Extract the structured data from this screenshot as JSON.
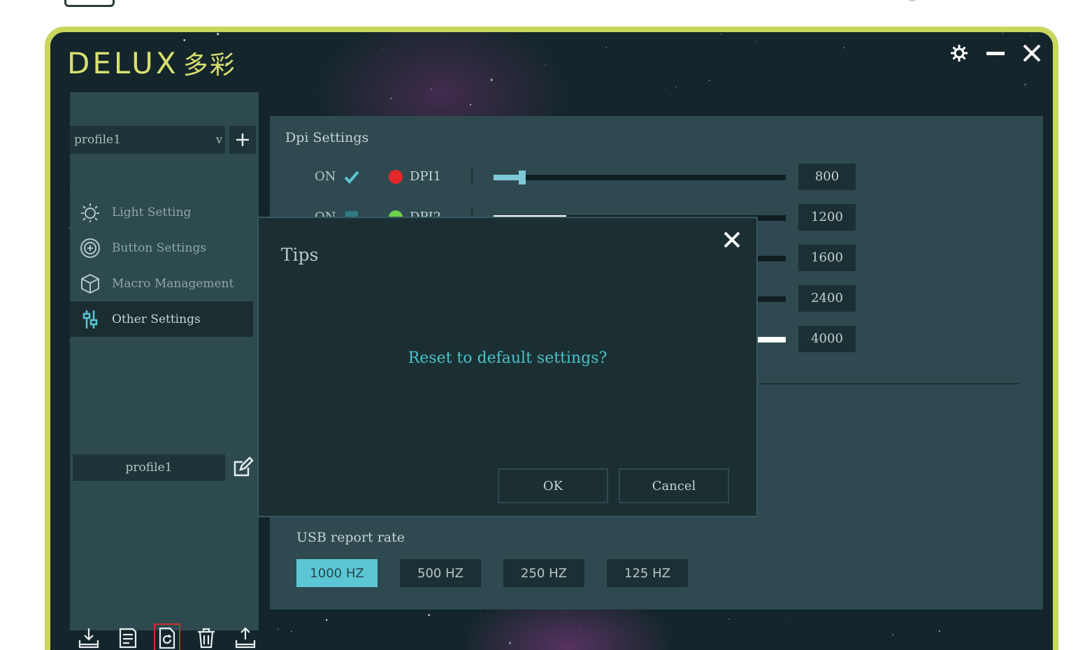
{
  "app": {
    "logo_text": "DELUX",
    "logo_cn": "多彩"
  },
  "window_controls": {
    "settings_icon": "gear-icon",
    "minimize_icon": "minimize-icon",
    "close_icon": "close-icon"
  },
  "sidebar": {
    "profile_select": {
      "value": "profile1",
      "caret": "v"
    },
    "add_profile_icon": "plus-icon",
    "menu": [
      {
        "label": "Light Setting",
        "icon": "sun-icon",
        "active": false
      },
      {
        "label": "Button Settings",
        "icon": "button-icon",
        "active": false
      },
      {
        "label": "Macro Management",
        "icon": "cube-icon",
        "active": false
      },
      {
        "label": "Other Settings",
        "icon": "sliders-icon",
        "active": true
      }
    ],
    "profile_name": "profile1",
    "edit_icon": "edit-icon",
    "toolbar": [
      {
        "icon": "import-icon"
      },
      {
        "icon": "save-icon"
      },
      {
        "icon": "reset-icon",
        "highlighted": true
      },
      {
        "icon": "trash-icon"
      },
      {
        "icon": "export-icon"
      }
    ]
  },
  "dpi_settings": {
    "title": "Dpi Settings",
    "rows": [
      {
        "on_label": "ON",
        "enabled": true,
        "name": "DPI1",
        "dot_color": "#e5282c",
        "value": "800",
        "fill_fraction": 0.1
      },
      {
        "on_label": "ON",
        "enabled": false,
        "name": "DPI2",
        "dot_color": "#6bd04a",
        "value": "1200",
        "fill_fraction": 0.25
      },
      {
        "on_label": "",
        "enabled": false,
        "name": "",
        "dot_color": "",
        "value": "1600",
        "fill_fraction": 0.33
      },
      {
        "on_label": "",
        "enabled": false,
        "name": "",
        "dot_color": "",
        "value": "2400",
        "fill_fraction": 0.5
      },
      {
        "on_label": "",
        "enabled": false,
        "name": "",
        "dot_color": "",
        "value": "4000",
        "fill_fraction": 1.0
      }
    ]
  },
  "usb": {
    "title": "USB report rate",
    "rates": [
      {
        "label": "1000 HZ",
        "selected": true
      },
      {
        "label": "500 HZ",
        "selected": false
      },
      {
        "label": "250 HZ",
        "selected": false
      },
      {
        "label": "125 HZ",
        "selected": false
      }
    ]
  },
  "dialog": {
    "title": "Tips",
    "message": "Reset to default settings?",
    "ok_label": "OK",
    "cancel_label": "Cancel",
    "close_icon": "close-icon"
  },
  "colors": {
    "frame_accent": "#c9d65f",
    "accent_cyan": "#5cc6d4",
    "message_cyan": "#49c2c9",
    "highlight_red": "#c8322c"
  }
}
